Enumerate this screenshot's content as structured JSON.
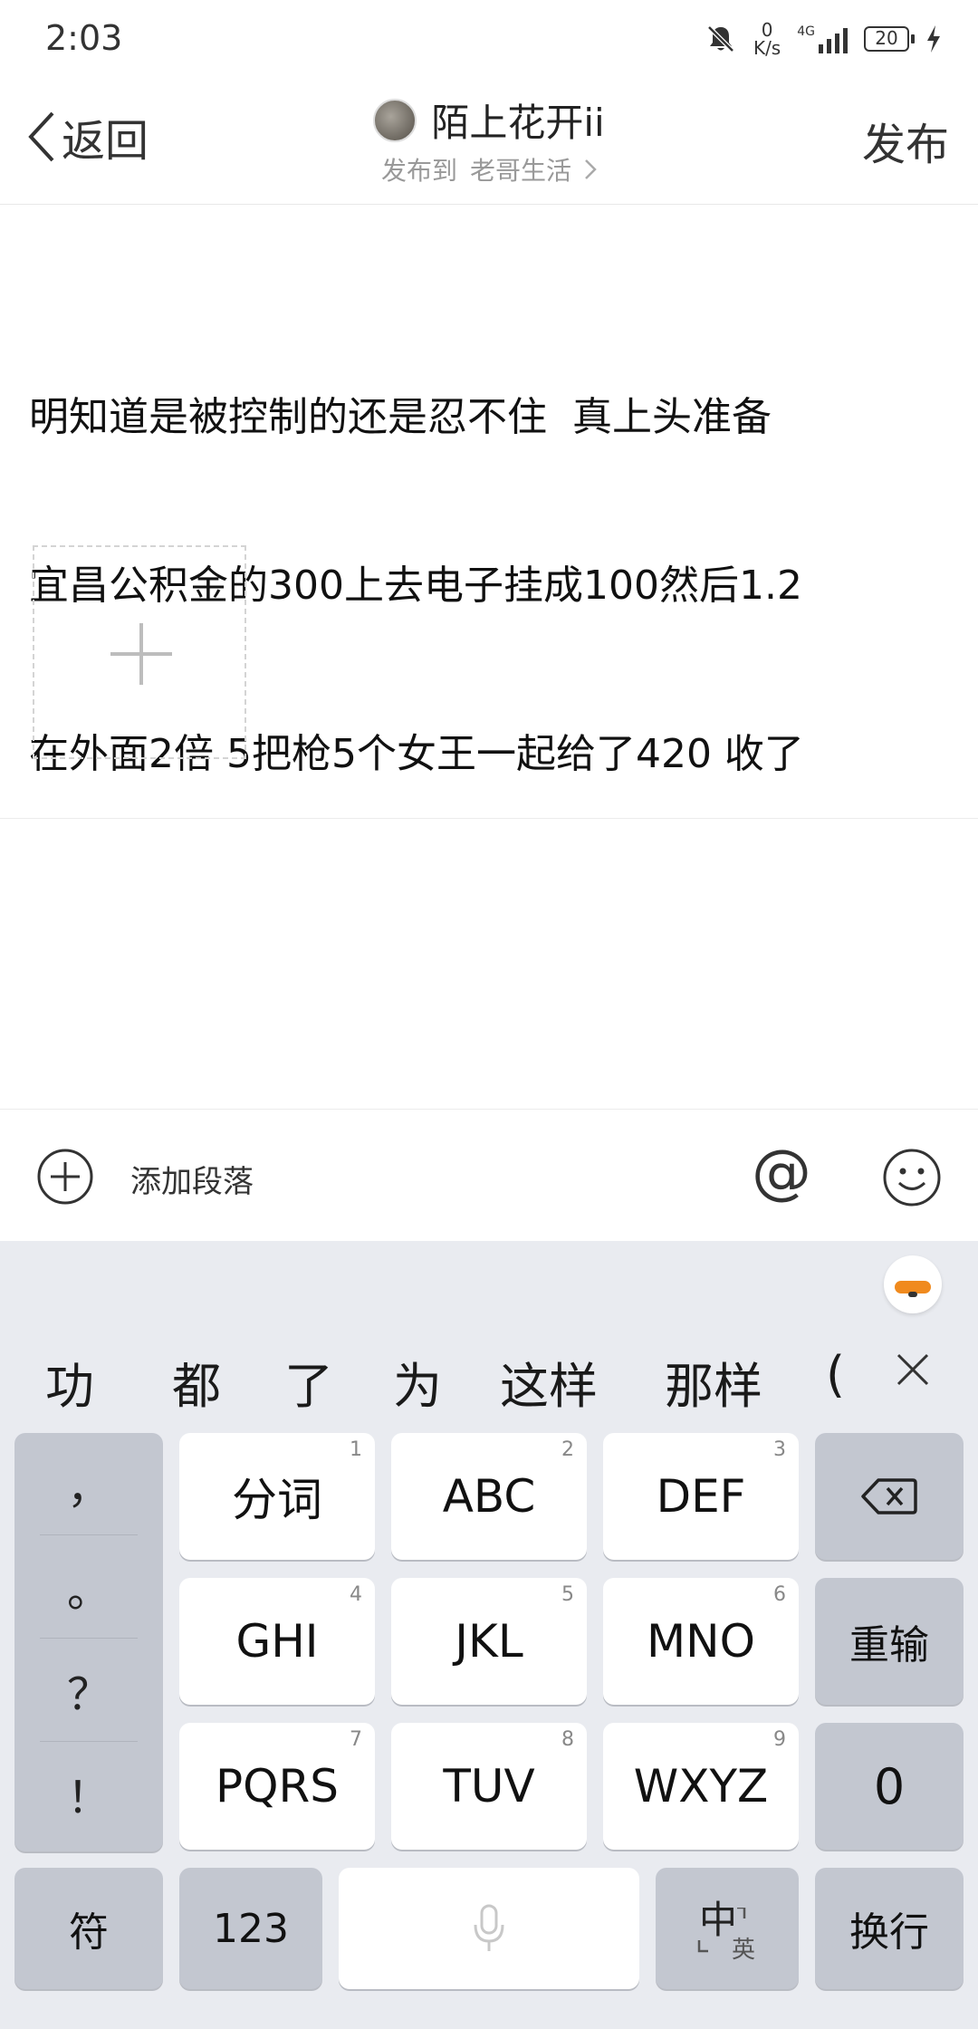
{
  "status_bar": {
    "time": "2:03",
    "net_speed_value": "0",
    "net_speed_unit": "K/s",
    "signal_label": "4G",
    "battery": "20"
  },
  "header": {
    "back_label": "返回",
    "username": "陌上花开ii",
    "publish_to_prefix": "发布到",
    "publish_to_target": "老哥生活",
    "publish_label": "发布"
  },
  "post": {
    "text_lines": [
      "明知道是被控制的还是忍不住  真上头准备",
      "宜昌公积金的300上去电子挂成100然后1.2",
      "在外面2倍 5把枪5个女王一起给了420 收了"
    ]
  },
  "toolbar": {
    "add_paragraph_label": "添加段落",
    "at_symbol": "@"
  },
  "keyboard": {
    "candidates": [
      "功",
      "都",
      "了",
      "为",
      "这样",
      "那样",
      "("
    ],
    "punctuation": [
      "，",
      "。",
      "？",
      "！"
    ],
    "rows": [
      [
        {
          "label": "分词",
          "num": "1"
        },
        {
          "label": "ABC",
          "num": "2"
        },
        {
          "label": "DEF",
          "num": "3"
        }
      ],
      [
        {
          "label": "GHI",
          "num": "4"
        },
        {
          "label": "JKL",
          "num": "5"
        },
        {
          "label": "MNO",
          "num": "6"
        }
      ],
      [
        {
          "label": "PQRS",
          "num": "7"
        },
        {
          "label": "TUV",
          "num": "8"
        },
        {
          "label": "WXYZ",
          "num": "9"
        }
      ]
    ],
    "reenter_label": "重输",
    "zero_label": "0",
    "symbols_label": "符",
    "numbers_label": "123",
    "lang_main": "中",
    "lang_alt": "英",
    "enter_label": "换行"
  }
}
